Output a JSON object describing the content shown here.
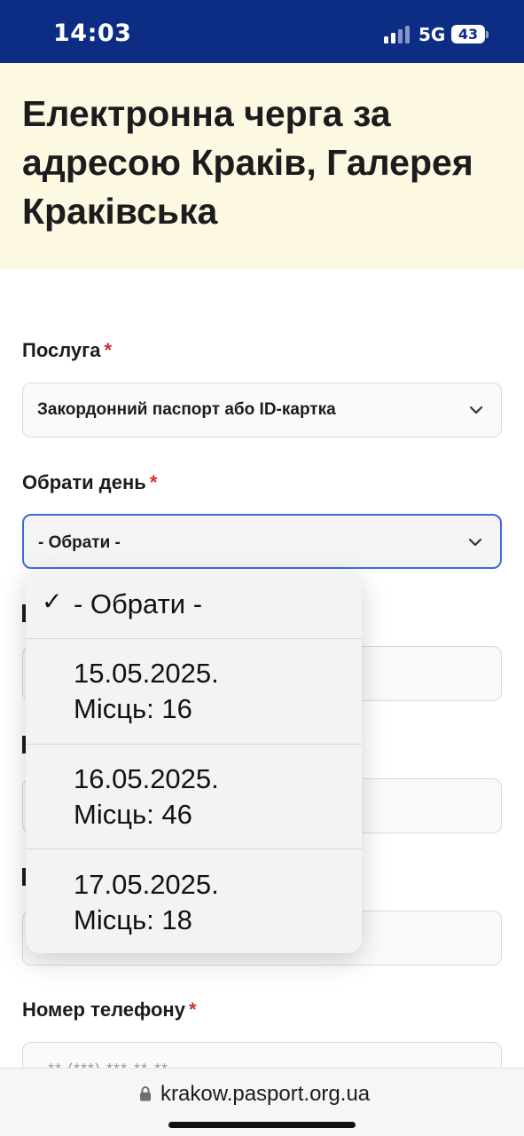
{
  "status_bar": {
    "time": "14:03",
    "network": "5G",
    "battery": "43"
  },
  "page_title": "Електронна черга за адресою Краків, Галерея Краківська",
  "form": {
    "service": {
      "label": "Послуга",
      "required_mark": "*",
      "value": "Закордонний паспорт або ID-картка"
    },
    "day": {
      "label": "Обрати день",
      "required_mark": "*",
      "value": "- Обрати -"
    },
    "phone": {
      "label": "Номер телефону",
      "required_mark": "*",
      "placeholder": "** (***) ***-**-**"
    }
  },
  "day_dropdown": {
    "options": [
      {
        "text": "- Обрати -",
        "selected": true
      },
      {
        "text": "15.05.2025.\nМісць: 16",
        "selected": false
      },
      {
        "text": "16.05.2025.\nМісць: 46",
        "selected": false
      },
      {
        "text": "17.05.2025.\nМісць: 18",
        "selected": false
      }
    ]
  },
  "browser": {
    "url": "krakow.pasport.org.ua"
  },
  "colors": {
    "brand_blue": "#0d2d85",
    "header_bg": "#fdf8e1",
    "required_red": "#d32f2f",
    "focus_blue": "#3d6bd6"
  }
}
